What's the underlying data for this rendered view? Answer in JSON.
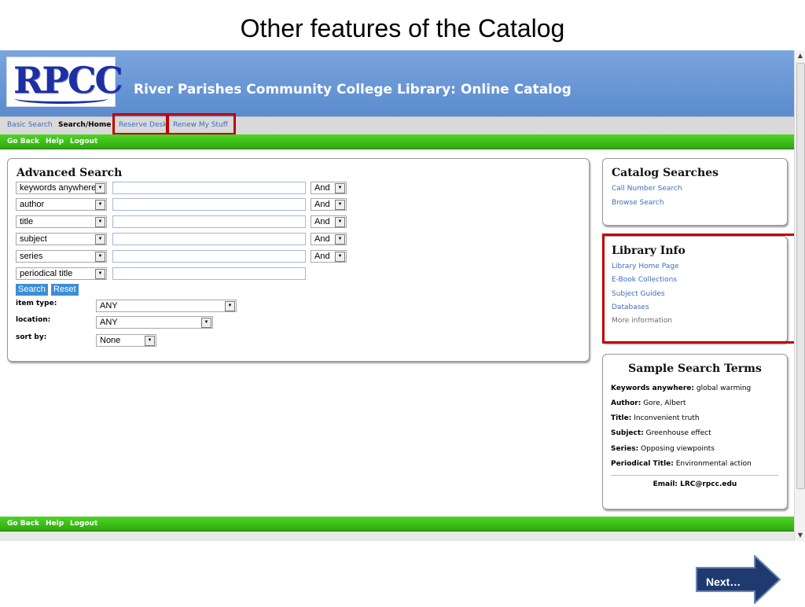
{
  "slide": {
    "title": "Other features of the Catalog",
    "next_label": "Next…"
  },
  "header": {
    "logo_text": "RPCC",
    "site_title": "River Parishes Community College Library: Online Catalog"
  },
  "tabs": [
    {
      "label": "Basic Search"
    },
    {
      "label": "Search/Home"
    },
    {
      "label": "Reserve Desk"
    },
    {
      "label": "Renew My Stuff"
    }
  ],
  "nav": {
    "go_back": "Go Back",
    "help": "Help",
    "logout": "Logout"
  },
  "advanced_search": {
    "title": "Advanced Search",
    "rows": [
      {
        "field": "keywords anywhere",
        "operator": "And"
      },
      {
        "field": "author",
        "operator": "And"
      },
      {
        "field": "title",
        "operator": "And"
      },
      {
        "field": "subject",
        "operator": "And"
      },
      {
        "field": "series",
        "operator": "And"
      },
      {
        "field": "periodical title",
        "operator": ""
      }
    ],
    "search_label": "Search",
    "reset_label": "Reset",
    "item_type_label": "item type:",
    "item_type_value": "ANY",
    "location_label": "location:",
    "location_value": "ANY",
    "sort_label": "sort by:",
    "sort_value": "None"
  },
  "catalog_searches": {
    "title": "Catalog Searches",
    "links": [
      "Call Number Search",
      "Browse Search"
    ]
  },
  "library_info": {
    "title": "Library Info",
    "links": [
      "Library Home Page",
      "E-Book Collections",
      "Subject Guides",
      "Databases",
      "More information"
    ]
  },
  "sample_terms": {
    "title": "Sample Search Terms",
    "items": [
      {
        "label": "Keywords anywhere:",
        "value": "global warming"
      },
      {
        "label": "Author:",
        "value": "Gore, Albert"
      },
      {
        "label": "Title:",
        "value": "Inconvenient truth"
      },
      {
        "label": "Subject:",
        "value": "Greenhouse effect"
      },
      {
        "label": "Series:",
        "value": "Opposing viewpoints"
      },
      {
        "label": "Periodical Title:",
        "value": "Environmental action"
      }
    ],
    "email": "Email: LRC@rpcc.edu"
  },
  "colors": {
    "highlight": "#c00000",
    "nav_green": "#34b217",
    "header_blue": "#6a98d5",
    "link_blue": "#3e6dbf"
  }
}
